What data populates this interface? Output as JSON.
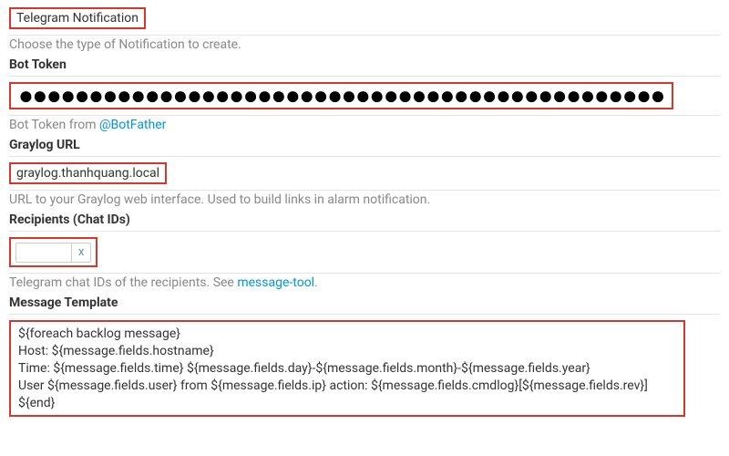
{
  "notification_type": {
    "value": "Telegram Notification",
    "help": "Choose the type of Notification to create."
  },
  "bot_token": {
    "label": "Bot Token",
    "value_masked": "●●●●●●●●●●●●●●●●●●●●●●●●●●●●●●●●●●●●●●●●●●●●●●",
    "help_prefix": "Bot Token from ",
    "help_link_text": "@BotFather"
  },
  "graylog_url": {
    "label": "Graylog URL",
    "value": "graylog.thanhquang.local",
    "help": "URL to your Graylog web interface. Used to build links in alarm notification."
  },
  "recipients": {
    "label": "Recipients (Chat IDs)",
    "tag_value": "",
    "tag_remove": "x",
    "help_prefix": "Telegram chat IDs of the recipients. See ",
    "help_link_text": "message-tool",
    "help_suffix": "."
  },
  "message_template": {
    "label": "Message Template",
    "value": "${foreach backlog message}\nHost: ${message.fields.hostname}\nTime: ${message.fields.time} ${message.fields.day}-${message.fields.month}-${message.fields.year}\nUser ${message.fields.user} from ${message.fields.ip} action: ${message.fields.cmdlog}[${message.fields.rev}]\n${end}"
  }
}
